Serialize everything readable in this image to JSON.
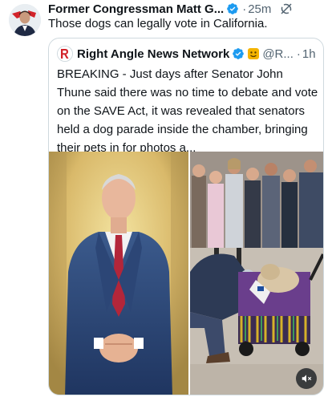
{
  "post": {
    "author_name": "Former Congressman Matt G...",
    "separator": "·",
    "timestamp": "25m",
    "text": "Those dogs can legally vote in California."
  },
  "quote": {
    "author_name": "Right Angle News Network",
    "handle": "@R...",
    "separator": "·",
    "timestamp": "1h",
    "text": "BREAKING - Just days after Senator John Thune said there was no time to debate and vote on the SAVE Act, it was revealed that senators held a dog parade inside the chamber, bringing their pets in for photos a..."
  },
  "icons": {
    "verified": "verified-badge-icon",
    "grok": "grok-icon",
    "mute": "speaker-muted-icon",
    "emoji": "emoji-badge-icon"
  },
  "colors": {
    "verified_blue": "#1d9bf0",
    "secondary_text": "#536471",
    "border": "#cfd9de",
    "brand_red": "#d2232a"
  }
}
